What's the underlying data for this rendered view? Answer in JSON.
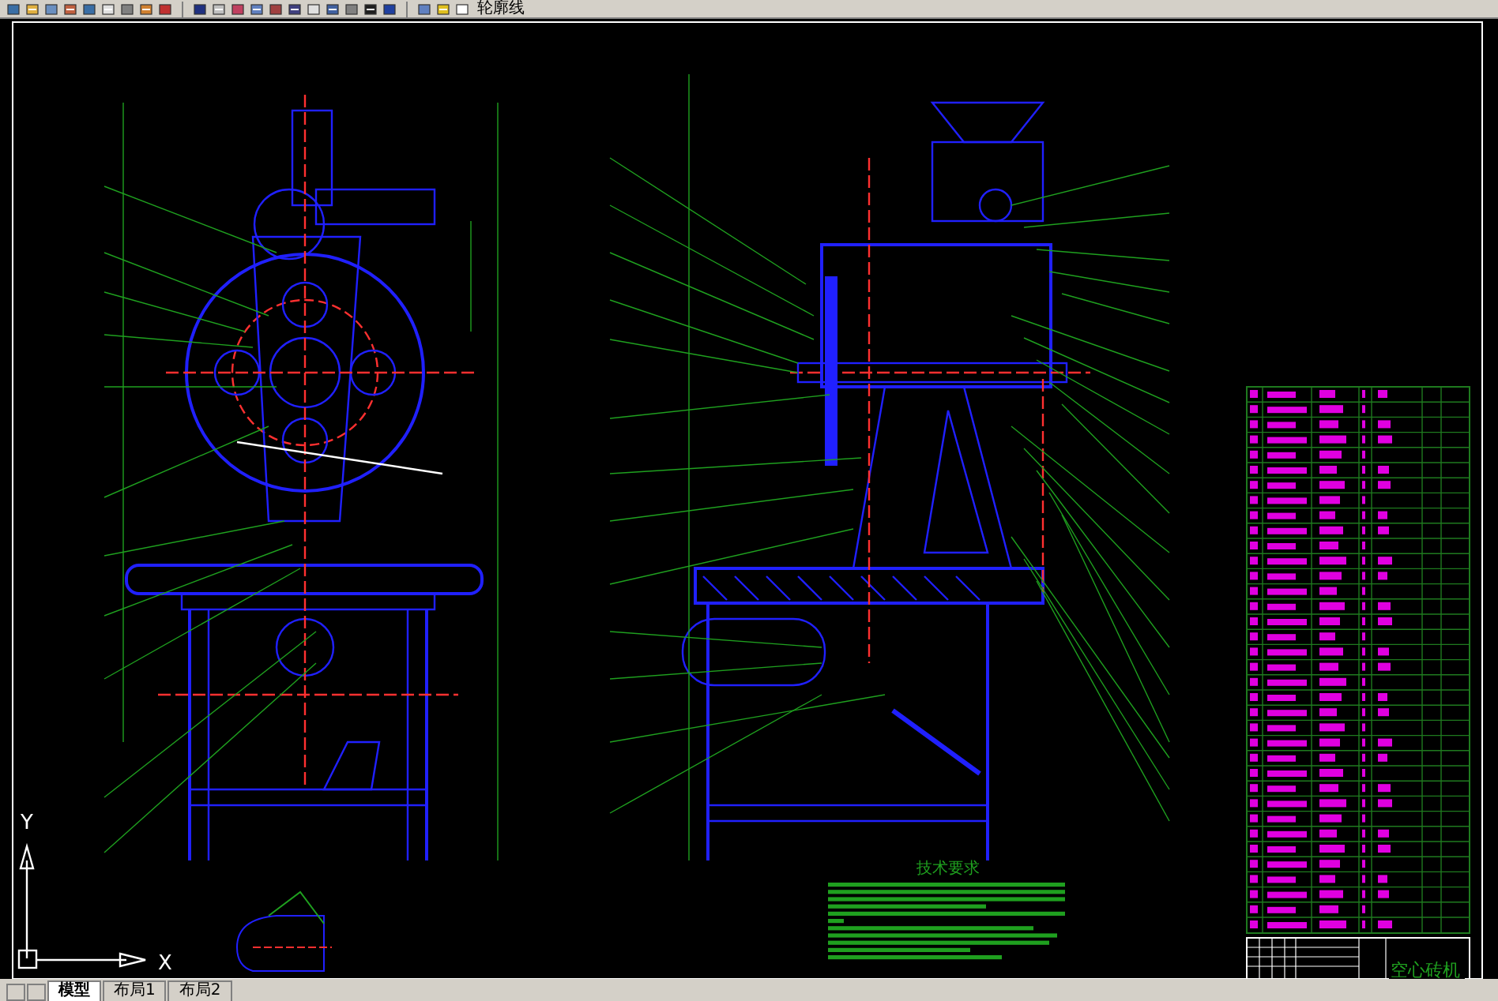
{
  "toolbar": {
    "layer_name": "轮廓线"
  },
  "drawing": {
    "notes_title": "技术要求",
    "title_block_name": "空心砖机"
  },
  "ucs": {
    "x_label": "X",
    "y_label": "Y"
  },
  "layout_tabs": [
    {
      "label": "模型",
      "selected": true
    },
    {
      "label": "布局1",
      "selected": false
    },
    {
      "label": "布局2",
      "selected": false
    }
  ]
}
